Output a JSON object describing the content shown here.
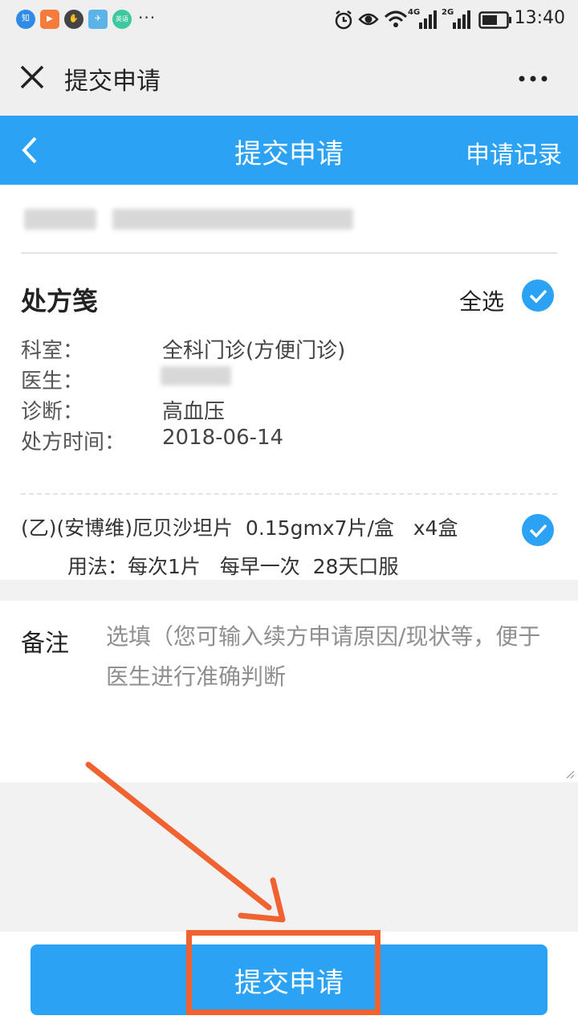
{
  "status_bar": {
    "apps": [
      {
        "icon": "zhihu-icon",
        "label": "知",
        "color": "#2f8be6"
      },
      {
        "icon": "video-play-icon",
        "label": "▶",
        "color": "#f47b3c"
      },
      {
        "icon": "hand-icon",
        "label": "✋",
        "color": "#444444"
      },
      {
        "icon": "paper-plane-icon",
        "label": "✈",
        "color": "#5cb3e8"
      },
      {
        "icon": "chat-app-icon",
        "label": "英语",
        "color": "#3cc8a0"
      }
    ],
    "more": "···",
    "network_4g": "4G",
    "network_2g": "2G",
    "time": "13:40"
  },
  "wechat_bar": {
    "title": "提交申请"
  },
  "header": {
    "title": "提交申请",
    "right_link": "申请记录",
    "color": "#2ba2f3"
  },
  "prescription": {
    "title": "处方笺",
    "select_all": "全选",
    "rows": [
      {
        "label": "科室：",
        "value": "全科门诊(方便门诊)"
      },
      {
        "label": "医生：",
        "value": ""
      },
      {
        "label": "诊断：",
        "value": "高血压"
      },
      {
        "label": "处方时间：",
        "value": "2018-06-14"
      }
    ],
    "drug": {
      "name": "(乙)(安博维)厄贝沙坦片  0.15gmx7片/盒   x4盒",
      "usage": "用法：每次1片   每早一次  28天口服"
    }
  },
  "remark": {
    "label": "备注",
    "placeholder": "选填（您可输入续方申请原因/现状等，便于医生进行准确判断"
  },
  "footer": {
    "submit_label": "提交申请"
  },
  "annotation_color": "#f0622f"
}
